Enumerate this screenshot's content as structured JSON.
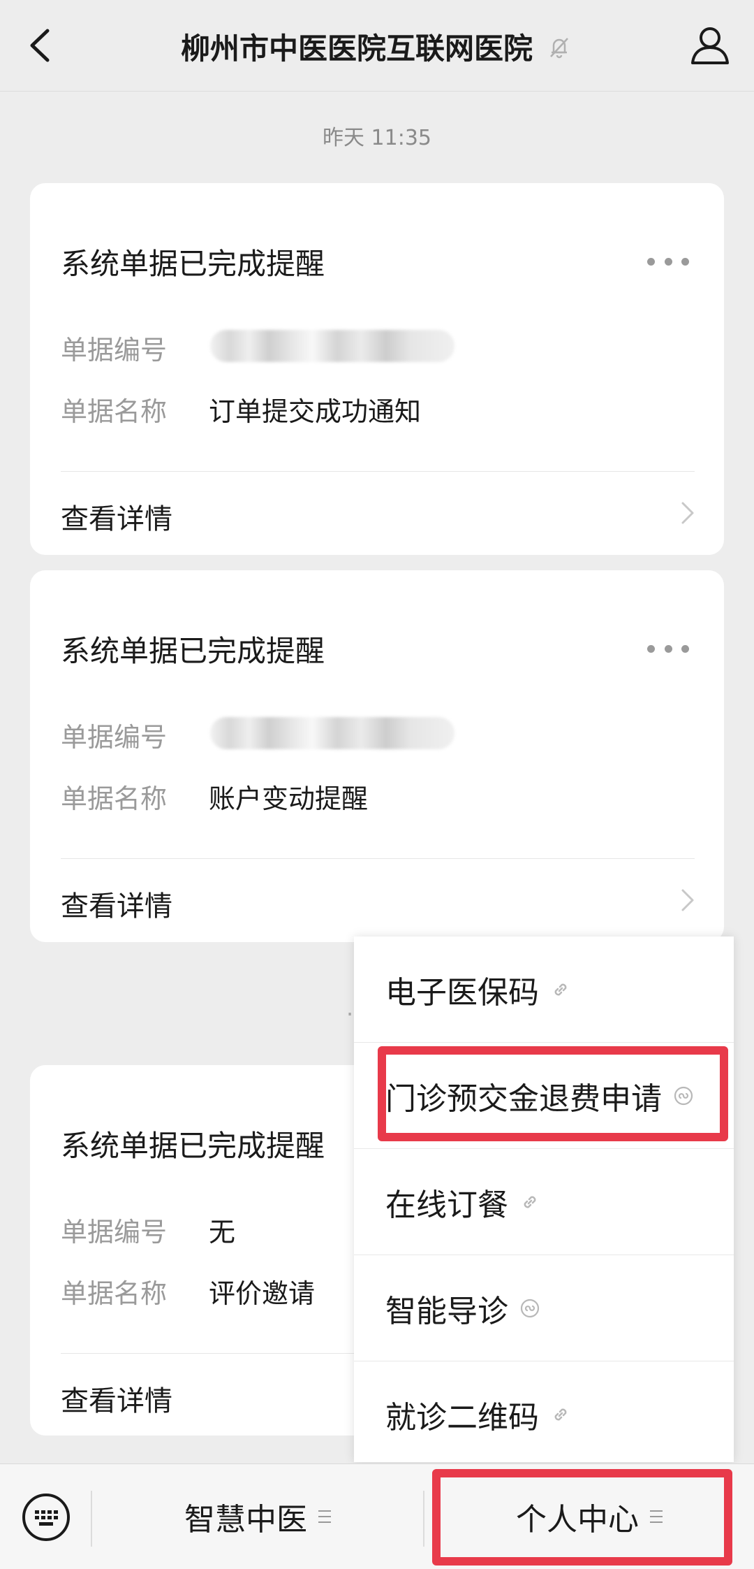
{
  "header": {
    "title": "柳州市中医医院互联网医院"
  },
  "timestamp": "昨天 11:35",
  "cards": [
    {
      "title": "系统单据已完成提醒",
      "number_label": "单据编号",
      "number_value": "",
      "name_label": "单据名称",
      "name_value": "订单提交成功通知",
      "detail": "查看详情"
    },
    {
      "title": "系统单据已完成提醒",
      "number_label": "单据编号",
      "number_value": "",
      "name_label": "单据名称",
      "name_value": "账户变动提醒",
      "detail": "查看详情"
    },
    {
      "title": "系统单据已完成提醒",
      "number_label": "单据编号",
      "number_value": "无",
      "name_label": "单据名称",
      "name_value": "评价邀请",
      "detail": "查看详情"
    }
  ],
  "menu": {
    "items": [
      {
        "label": "电子医保码",
        "icon": "link-icon"
      },
      {
        "label": "门诊预交金退费申请",
        "icon": "mini-program-icon"
      },
      {
        "label": "在线订餐",
        "icon": "link-icon"
      },
      {
        "label": "智能导诊",
        "icon": "mini-program-icon"
      },
      {
        "label": "就诊二维码",
        "icon": "link-icon"
      }
    ]
  },
  "tabbar": {
    "tab1": "智慧中医",
    "tab2": "个人中心"
  },
  "colors": {
    "highlight": "#e83a4a",
    "background": "#ededed"
  }
}
